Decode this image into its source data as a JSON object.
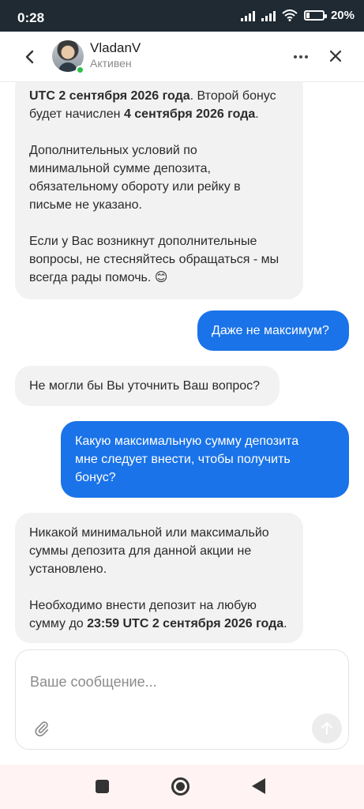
{
  "status_bar": {
    "time": "0:28",
    "battery": "20%",
    "battery_level": 0.2
  },
  "header": {
    "agent_name": "VladanV",
    "agent_status": "Активен"
  },
  "messages": [
    {
      "from": "agent",
      "p1_a": "UTC 2 сентября 2026 года",
      "p1_b": ". Второй бонус будет начислен ",
      "p1_c": "4 сентября 2026 года",
      "p1_d": ".",
      "p2": "Дополнительных условий по\nминимальной сумме депозита,\nобязательному обороту или рейку в\nписьме не указано.",
      "p3": "Если у Вас возникнут дополнительные\nвопросы, не стесняйтесь обращаться - мы\nвсегда рады помочь. 😊"
    },
    {
      "from": "user",
      "text": "Даже не максимум?"
    },
    {
      "from": "agent",
      "text": "Не могли бы Вы уточнить Ваш вопрос?"
    },
    {
      "from": "user",
      "text": "Какую максимальную сумму депозита\nмне следует внести, чтобы получить\nбонус?"
    },
    {
      "from": "agent",
      "p1": "Никакой минимальной или максимальйо\nсуммы депозита для данной акции не\nустановлено.",
      "p2_a": "Необходимо внести депозит на любую\nсумму до ",
      "p2_b": "23:59 UTC 2 сентября 2026 года",
      "p2_c": "."
    }
  ],
  "composer": {
    "placeholder": "Ваше сообщение..."
  },
  "icons": {
    "back": "chevron-left-icon",
    "more": "more-horizontal-icon",
    "close": "close-icon",
    "attach": "paperclip-icon",
    "send": "send-arrow-icon"
  },
  "colors": {
    "user_bubble": "#1a73e8",
    "agent_bubble": "#f2f2f2",
    "online": "#2fbf4a",
    "status_bar": "#1f2a33"
  }
}
